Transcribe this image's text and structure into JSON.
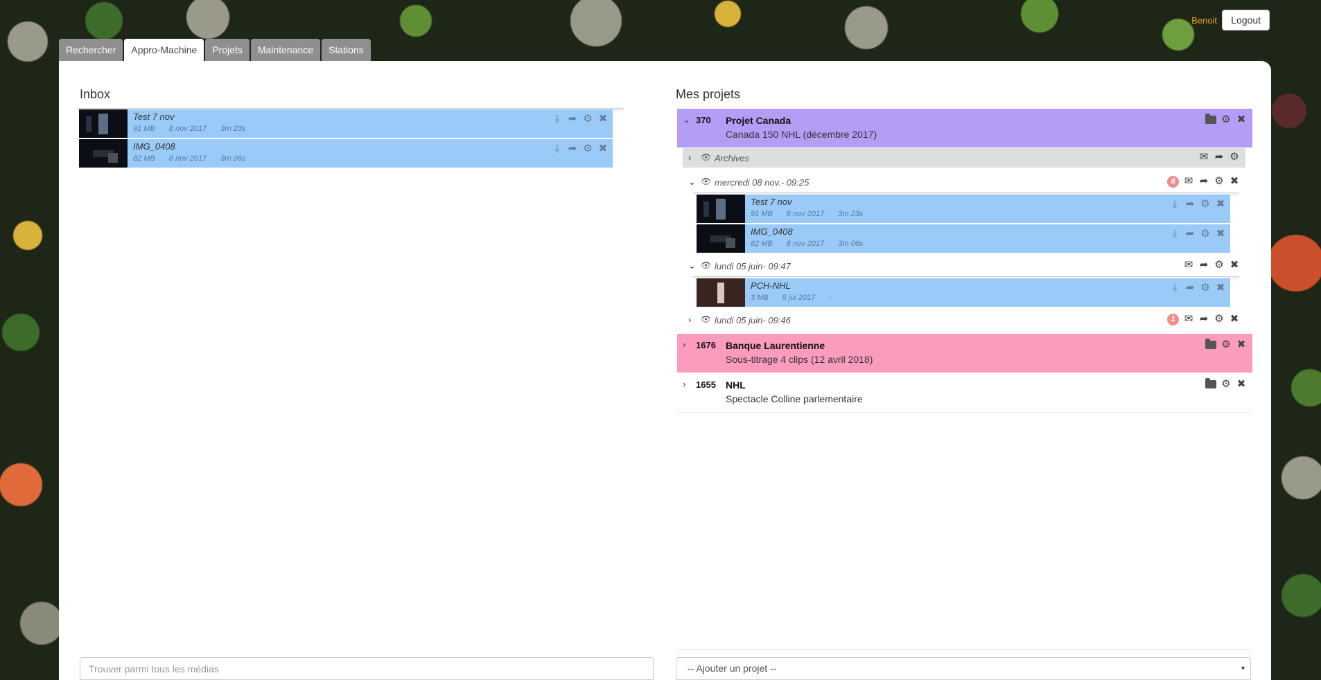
{
  "header": {
    "user": "Benoit",
    "logout_label": "Logout",
    "tabs": [
      {
        "label": "Rechercher",
        "active": false
      },
      {
        "label": "Appro-Machine",
        "active": true
      },
      {
        "label": "Projets",
        "active": false
      },
      {
        "label": "Maintenance",
        "active": false
      },
      {
        "label": "Stations",
        "active": false
      }
    ]
  },
  "inbox": {
    "title": "Inbox",
    "items": [
      {
        "name": "Test 7 nov",
        "size": "91 MB",
        "date": "8 nov 2017",
        "duration": "3m 23s"
      },
      {
        "name": "IMG_0408",
        "size": "82 MB",
        "date": "8 nov 2017",
        "duration": "3m 06s"
      }
    ]
  },
  "projects": {
    "title": "Mes projets",
    "list": [
      {
        "number": "370",
        "name": "Projet Canada",
        "subtitle": "Canada 150 NHL (décembre 2017)",
        "color": "#b49ef5",
        "groups": [
          {
            "label": "Archives",
            "badge": "",
            "items": []
          },
          {
            "label": "mercredi 08 nov.- 09:25",
            "badge": "8",
            "items": [
              {
                "name": "Test 7 nov",
                "size": "91 MB",
                "date": "8 nov 2017",
                "duration": "3m 23s"
              },
              {
                "name": "IMG_0408",
                "size": "82 MB",
                "date": "8 nov 2017",
                "duration": "3m 06s"
              }
            ]
          },
          {
            "label": "lundi 05 juin- 09:47",
            "badge": "",
            "items": [
              {
                "name": "PCH-NHL",
                "size": "3 MB",
                "date": "5 jui 2017",
                "duration": "-"
              }
            ]
          },
          {
            "label": "lundi 05 juin- 09:46",
            "badge": "1",
            "items": []
          }
        ]
      },
      {
        "number": "1676",
        "name": "Banque Laurentienne",
        "subtitle": "Sous-titrage 4 clips (12 avril 2018)",
        "color": "#fb9bbd"
      },
      {
        "number": "1655",
        "name": "NHL",
        "subtitle": "Spectacle Colline parlementaire",
        "color": "#ffffff"
      }
    ]
  },
  "footer": {
    "search_placeholder": "Trouver parmi tous les médias",
    "add_project_label": "-- Ajouter un projet --"
  },
  "icons": {
    "download": "download-icon",
    "share": "share-icon",
    "gear": "gear-icon",
    "close": "close-icon",
    "eye": "eye-icon",
    "mail": "mail-icon",
    "folder": "folder-icon",
    "chevron_down": "chevron-down-icon",
    "chevron_right": "chevron-right-icon"
  }
}
